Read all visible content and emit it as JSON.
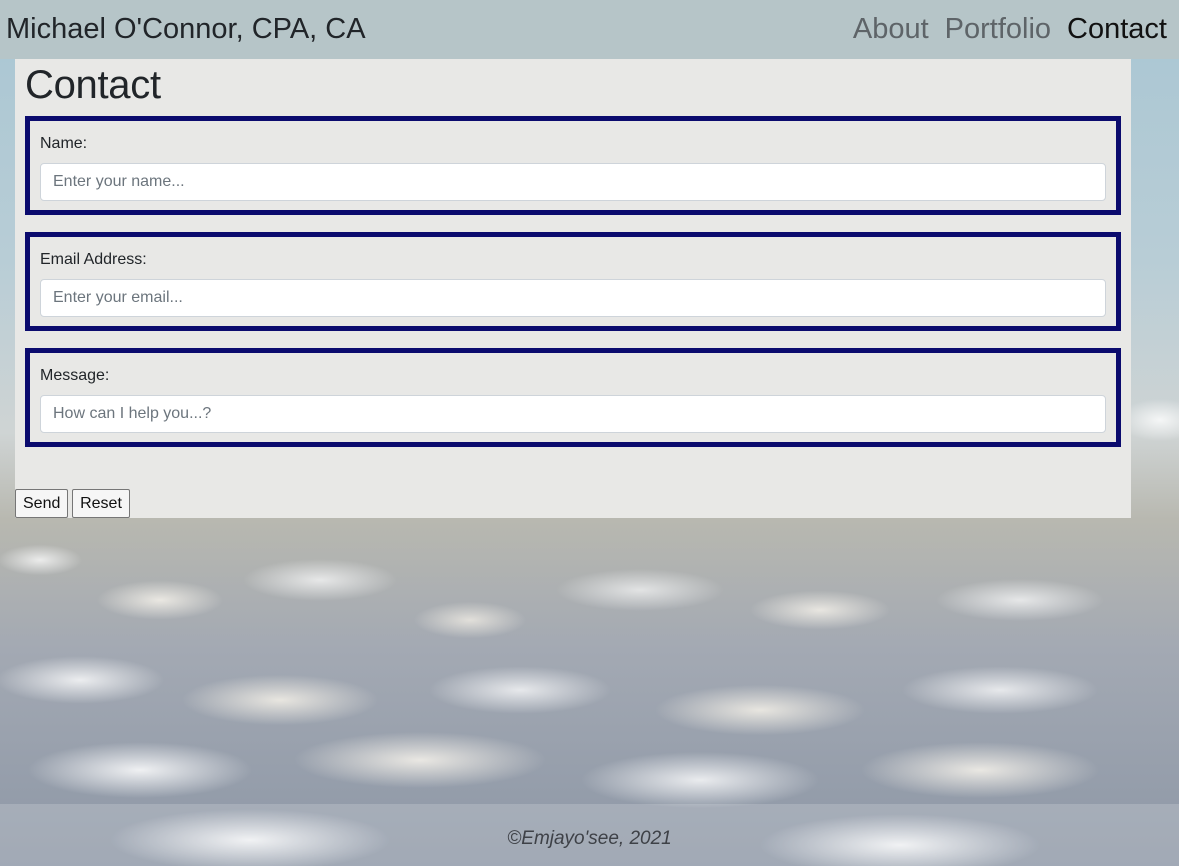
{
  "header": {
    "brand": "Michael O'Connor, CPA, CA",
    "nav": [
      {
        "label": "About",
        "active": false
      },
      {
        "label": "Portfolio",
        "active": false
      },
      {
        "label": "Contact",
        "active": true
      }
    ]
  },
  "contact": {
    "title": "Contact",
    "fields": [
      {
        "label": "Name:",
        "placeholder": "Enter your name...",
        "value": ""
      },
      {
        "label": "Email Address:",
        "placeholder": "Enter your email...",
        "value": ""
      },
      {
        "label": "Message:",
        "placeholder": "How can I help you...?",
        "value": ""
      }
    ],
    "send_label": "Send",
    "reset_label": "Reset"
  },
  "footer": {
    "text": "©Emjayo'see, 2021"
  },
  "colors": {
    "header_bg": "#b6c5c8",
    "panel_bg": "#e8e8e6",
    "field_border": "#0b0b6e",
    "nav_inactive": "#5e6468",
    "nav_active": "#111111"
  }
}
